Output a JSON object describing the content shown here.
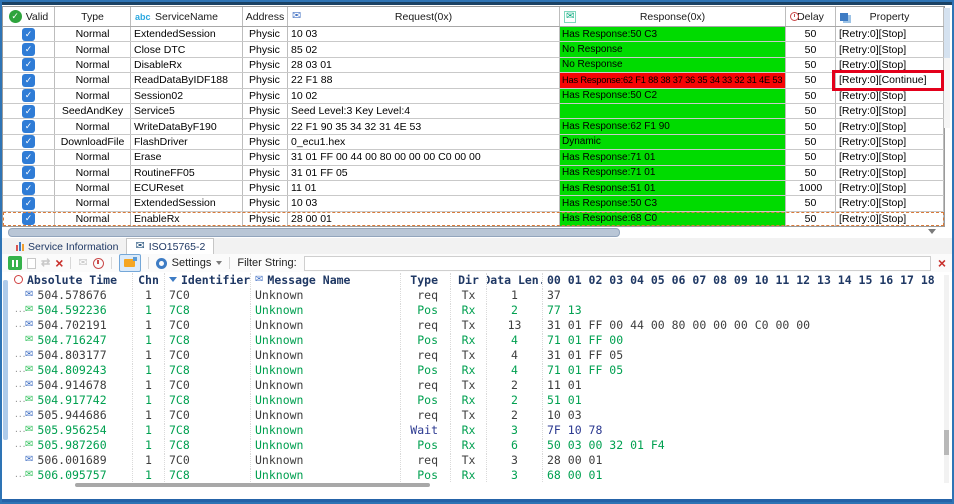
{
  "colors": {
    "accent_blue": "#2E74B5",
    "response_ok_bg": "#00DB00",
    "response_error_bg": "#F60505",
    "highlight_red": "#E3001B",
    "trace_tx": "#3E3E3E",
    "trace_rx": "#00A050",
    "trace_wait": "#2B3990",
    "checkbox_blue": "#2F7CD6",
    "valid_green": "#2EA43C"
  },
  "service_table": {
    "headers": {
      "valid": "Valid",
      "type": "Type",
      "service_abc": "abc",
      "service": "ServiceName",
      "address": "Address",
      "request": "Request(0x)",
      "response": "Response(0x)",
      "delay": "Delay",
      "property": "Property"
    },
    "rows": [
      {
        "type": "Normal",
        "service": "ExtendedSession",
        "address": "Physic",
        "request": "10 03",
        "response": "Has Response:50 C3",
        "state": "ok",
        "delay": "50",
        "property": "[Retry:0][Stop]"
      },
      {
        "type": "Normal",
        "service": "Close DTC",
        "address": "Physic",
        "request": "85 02",
        "response": "No Response",
        "state": "ok",
        "delay": "50",
        "property": "[Retry:0][Stop]"
      },
      {
        "type": "Normal",
        "service": "DisableRx",
        "address": "Physic",
        "request": "28 03 01",
        "response": "No Response",
        "state": "ok",
        "delay": "50",
        "property": "[Retry:0][Stop]"
      },
      {
        "type": "Normal",
        "service": "ReadDataByIDF188",
        "address": "Physic",
        "request": "22 F1 88",
        "response": "Has Response:62 F1 88 38 37 36 35 34 33 32 31 4E 53",
        "state": "error",
        "delay": "50",
        "property": "[Retry:0][Continue]",
        "hl": "y"
      },
      {
        "type": "Normal",
        "service": "Session02",
        "address": "Physic",
        "request": "10 02",
        "response": "Has Response:50 C2",
        "state": "ok",
        "delay": "50",
        "property": "[Retry:0][Stop]"
      },
      {
        "type": "SeedAndKey",
        "service": "Service5",
        "address": "Physic",
        "request": "Seed Level:3 Key Level:4",
        "response": "",
        "state": "ok",
        "delay": "50",
        "property": "[Retry:0][Stop]"
      },
      {
        "type": "Normal",
        "service": "WriteDataByF190",
        "address": "Physic",
        "request": "22 F1 90 35 34 32 31 4E 53",
        "response": "Has Response:62 F1 90",
        "state": "ok",
        "delay": "50",
        "property": "[Retry:0][Stop]"
      },
      {
        "type": "DownloadFile",
        "service": "FlashDriver",
        "address": "Physic",
        "request": "0_ecu1.hex",
        "response": "Dynamic",
        "state": "ok",
        "delay": "50",
        "property": "[Retry:0][Stop]"
      },
      {
        "type": "Normal",
        "service": "Erase",
        "address": "Physic",
        "request": "31 01 FF 00 44 00 80 00 00 00 C0 00 00",
        "response": "Has Response:71 01",
        "state": "ok",
        "delay": "50",
        "property": "[Retry:0][Stop]"
      },
      {
        "type": "Normal",
        "service": "RoutineFF05",
        "address": "Physic",
        "request": "31 01 FF 05",
        "response": "Has Response:71 01",
        "state": "ok",
        "delay": "50",
        "property": "[Retry:0][Stop]"
      },
      {
        "type": "Normal",
        "service": "ECUReset",
        "address": "Physic",
        "request": "11 01",
        "response": "Has Response:51 01",
        "state": "ok",
        "delay": "1000",
        "property": "[Retry:0][Stop]"
      },
      {
        "type": "Normal",
        "service": "ExtendedSession",
        "address": "Physic",
        "request": "10 03",
        "response": "Has Response:50 C3",
        "state": "ok",
        "delay": "50",
        "property": "[Retry:0][Stop]"
      },
      {
        "type": "Normal",
        "service": "EnableRx",
        "address": "Physic",
        "request": "28 00 01",
        "response": "Has Response:68 C0",
        "state": "ok",
        "delay": "50",
        "property": "[Retry:0][Stop]"
      }
    ]
  },
  "tabs": {
    "service_info": "Service Information",
    "iso": "ISO15765-2"
  },
  "toolbar": {
    "settings": "Settings",
    "filter_label": "Filter String:",
    "filter_value": ""
  },
  "trace": {
    "headers": {
      "time": "Absolute Time",
      "chn": "Chn",
      "id": "Identifier",
      "name": "Message Name",
      "type": "Type",
      "dir": "Dir",
      "len": "Data Len.",
      "bytes": "00 01 02 03 04 05 06 07 08 09 10 11 12 13 14 15 16 17 18"
    },
    "rows": [
      {
        "dots": "",
        "time": "504.578676",
        "chn": "1",
        "id": "7C0",
        "name": "Unknown",
        "type": "req",
        "dir": "Tx",
        "len": "1",
        "data": "37",
        "c": "tx"
      },
      {
        "dots": "...",
        "time": "504.592236",
        "chn": "1",
        "id": "7C8",
        "name": "Unknown",
        "type": "Pos",
        "dir": "Rx",
        "len": "2",
        "data": "77 13",
        "c": "rx"
      },
      {
        "dots": "...",
        "time": "504.702191",
        "chn": "1",
        "id": "7C0",
        "name": "Unknown",
        "type": "req",
        "dir": "Tx",
        "len": "13",
        "data": "31 01 FF 00 44 00 80 00 00 00 C0 00 00",
        "c": "tx"
      },
      {
        "dots": "",
        "time": "504.716247",
        "chn": "1",
        "id": "7C8",
        "name": "Unknown",
        "type": "Pos",
        "dir": "Rx",
        "len": "4",
        "data": "71 01 FF 00",
        "c": "rx"
      },
      {
        "dots": "...",
        "time": "504.803177",
        "chn": "1",
        "id": "7C0",
        "name": "Unknown",
        "type": "req",
        "dir": "Tx",
        "len": "4",
        "data": "31 01 FF 05",
        "c": "tx"
      },
      {
        "dots": "...",
        "time": "504.809243",
        "chn": "1",
        "id": "7C8",
        "name": "Unknown",
        "type": "Pos",
        "dir": "Rx",
        "len": "4",
        "data": "71 01 FF 05",
        "c": "rx"
      },
      {
        "dots": "...",
        "time": "504.914678",
        "chn": "1",
        "id": "7C0",
        "name": "Unknown",
        "type": "req",
        "dir": "Tx",
        "len": "2",
        "data": "11 01",
        "c": "tx"
      },
      {
        "dots": "...",
        "time": "504.917742",
        "chn": "1",
        "id": "7C8",
        "name": "Unknown",
        "type": "Pos",
        "dir": "Rx",
        "len": "2",
        "data": "51 01",
        "c": "rx"
      },
      {
        "dots": "...",
        "time": "505.944686",
        "chn": "1",
        "id": "7C0",
        "name": "Unknown",
        "type": "req",
        "dir": "Tx",
        "len": "2",
        "data": "10 03",
        "c": "tx"
      },
      {
        "dots": "...",
        "time": "505.956254",
        "chn": "1",
        "id": "7C8",
        "name": "Unknown",
        "type": "Wait",
        "dir": "Rx",
        "len": "3",
        "data": "7F 10 78",
        "c": "rx",
        "tc": "wait",
        "dc": "wait"
      },
      {
        "dots": "...",
        "time": "505.987260",
        "chn": "1",
        "id": "7C8",
        "name": "Unknown",
        "type": "Pos",
        "dir": "Rx",
        "len": "6",
        "data": "50 03 00 32 01 F4",
        "c": "rx"
      },
      {
        "dots": "",
        "time": "506.001689",
        "chn": "1",
        "id": "7C0",
        "name": "Unknown",
        "type": "req",
        "dir": "Tx",
        "len": "3",
        "data": "28 00 01",
        "c": "tx"
      },
      {
        "dots": "...",
        "time": "506.095757",
        "chn": "1",
        "id": "7C8",
        "name": "Unknown",
        "type": "Pos",
        "dir": "Rx",
        "len": "3",
        "data": "68 00 01",
        "c": "rx"
      }
    ]
  }
}
